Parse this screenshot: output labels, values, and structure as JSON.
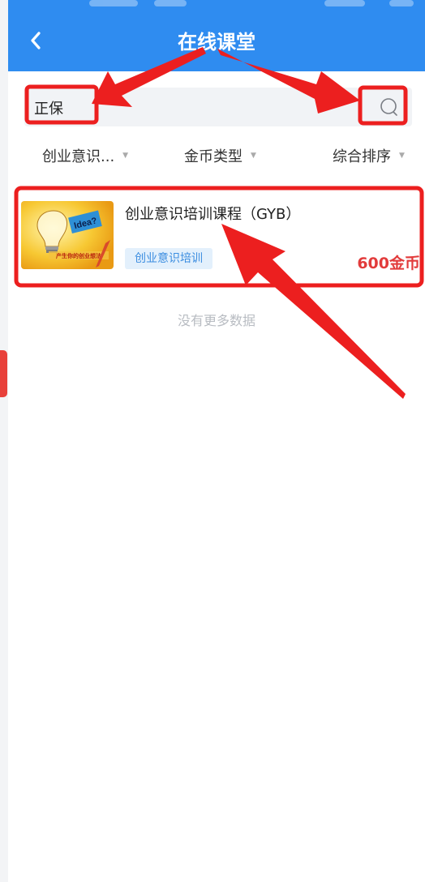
{
  "header": {
    "title": "在线课堂",
    "background_color": "#2f8cf0",
    "back_icon": "chevron-left-icon"
  },
  "search": {
    "value": "正保",
    "icon": "search-icon"
  },
  "filters": [
    {
      "label": "创业意识...",
      "icon": "caret-down-icon"
    },
    {
      "label": "金币类型",
      "icon": "caret-down-icon"
    },
    {
      "label": "综合排序",
      "icon": "caret-down-icon"
    }
  ],
  "courses": [
    {
      "title": "创业意识培训课程（GYB）",
      "tag": "创业意识培训",
      "price": "600金币",
      "thumbnail": {
        "bubble_text": "Idea?",
        "caption": "产生你的创业想法"
      }
    }
  ],
  "list_footer": "没有更多数据",
  "annotations": {
    "color": "#ec1f1f",
    "note": "red highlight boxes and arrows on search field, search button and course card"
  }
}
